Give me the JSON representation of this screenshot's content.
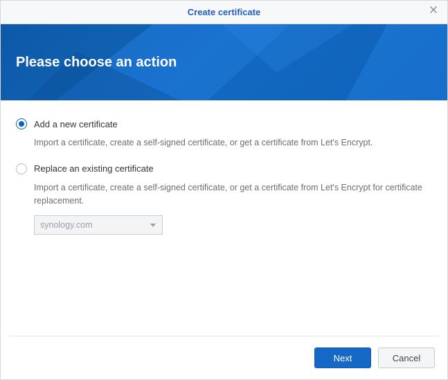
{
  "titlebar": {
    "title": "Create certificate"
  },
  "banner": {
    "heading": "Please choose an action"
  },
  "options": {
    "add": {
      "label": "Add a new certificate",
      "description": "Import a certificate, create a self-signed certificate, or get a certificate from Let's Encrypt.",
      "selected": true
    },
    "replace": {
      "label": "Replace an existing certificate",
      "description": "Import a certificate, create a self-signed certificate, or get a certificate from Let's Encrypt for certificate replacement.",
      "selected": false,
      "dropdown_value": "synology.com"
    }
  },
  "footer": {
    "next": "Next",
    "cancel": "Cancel"
  }
}
